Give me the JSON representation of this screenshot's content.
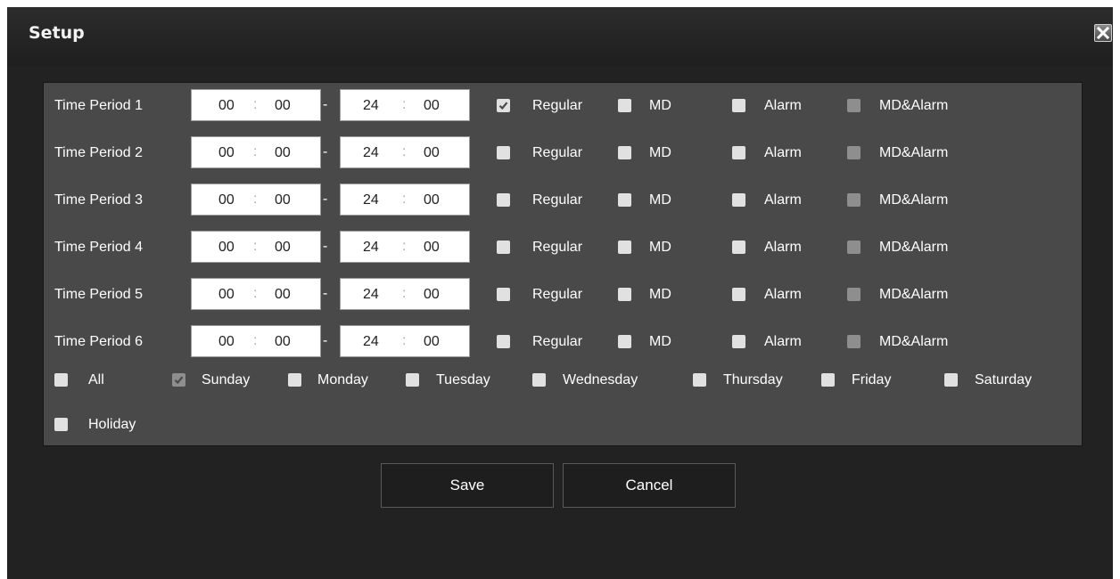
{
  "dialog": {
    "title": "Setup"
  },
  "periods": [
    {
      "label": "Time Period 1",
      "start_h": "00",
      "start_m": "00",
      "end_h": "24",
      "end_m": "00",
      "regular": true,
      "md": false,
      "alarm": false,
      "md_alarm": false
    },
    {
      "label": "Time Period 2",
      "start_h": "00",
      "start_m": "00",
      "end_h": "24",
      "end_m": "00",
      "regular": false,
      "md": false,
      "alarm": false,
      "md_alarm": false
    },
    {
      "label": "Time Period 3",
      "start_h": "00",
      "start_m": "00",
      "end_h": "24",
      "end_m": "00",
      "regular": false,
      "md": false,
      "alarm": false,
      "md_alarm": false
    },
    {
      "label": "Time Period 4",
      "start_h": "00",
      "start_m": "00",
      "end_h": "24",
      "end_m": "00",
      "regular": false,
      "md": false,
      "alarm": false,
      "md_alarm": false
    },
    {
      "label": "Time Period 5",
      "start_h": "00",
      "start_m": "00",
      "end_h": "24",
      "end_m": "00",
      "regular": false,
      "md": false,
      "alarm": false,
      "md_alarm": false
    },
    {
      "label": "Time Period 6",
      "start_h": "00",
      "start_m": "00",
      "end_h": "24",
      "end_m": "00",
      "regular": false,
      "md": false,
      "alarm": false,
      "md_alarm": false
    }
  ],
  "labels": {
    "separator": "-",
    "colon": ":",
    "regular": "Regular",
    "md": "MD",
    "alarm": "Alarm",
    "md_alarm": "MD&Alarm"
  },
  "days": {
    "all": {
      "label": "All",
      "checked": false
    },
    "sunday": {
      "label": "Sunday",
      "checked": true,
      "disabled": true
    },
    "monday": {
      "label": "Monday",
      "checked": false
    },
    "tuesday": {
      "label": "Tuesday",
      "checked": false
    },
    "wednesday": {
      "label": "Wednesday",
      "checked": false
    },
    "thursday": {
      "label": "Thursday",
      "checked": false
    },
    "friday": {
      "label": "Friday",
      "checked": false
    },
    "saturday": {
      "label": "Saturday",
      "checked": false
    },
    "holiday": {
      "label": "Holiday",
      "checked": false
    }
  },
  "buttons": {
    "save": "Save",
    "cancel": "Cancel"
  },
  "colors": {
    "dialog_bg": "#222222",
    "panel_bg": "#494949",
    "checkbox": "#e1e1e1",
    "checkbox_disabled": "#8e8e8e"
  }
}
